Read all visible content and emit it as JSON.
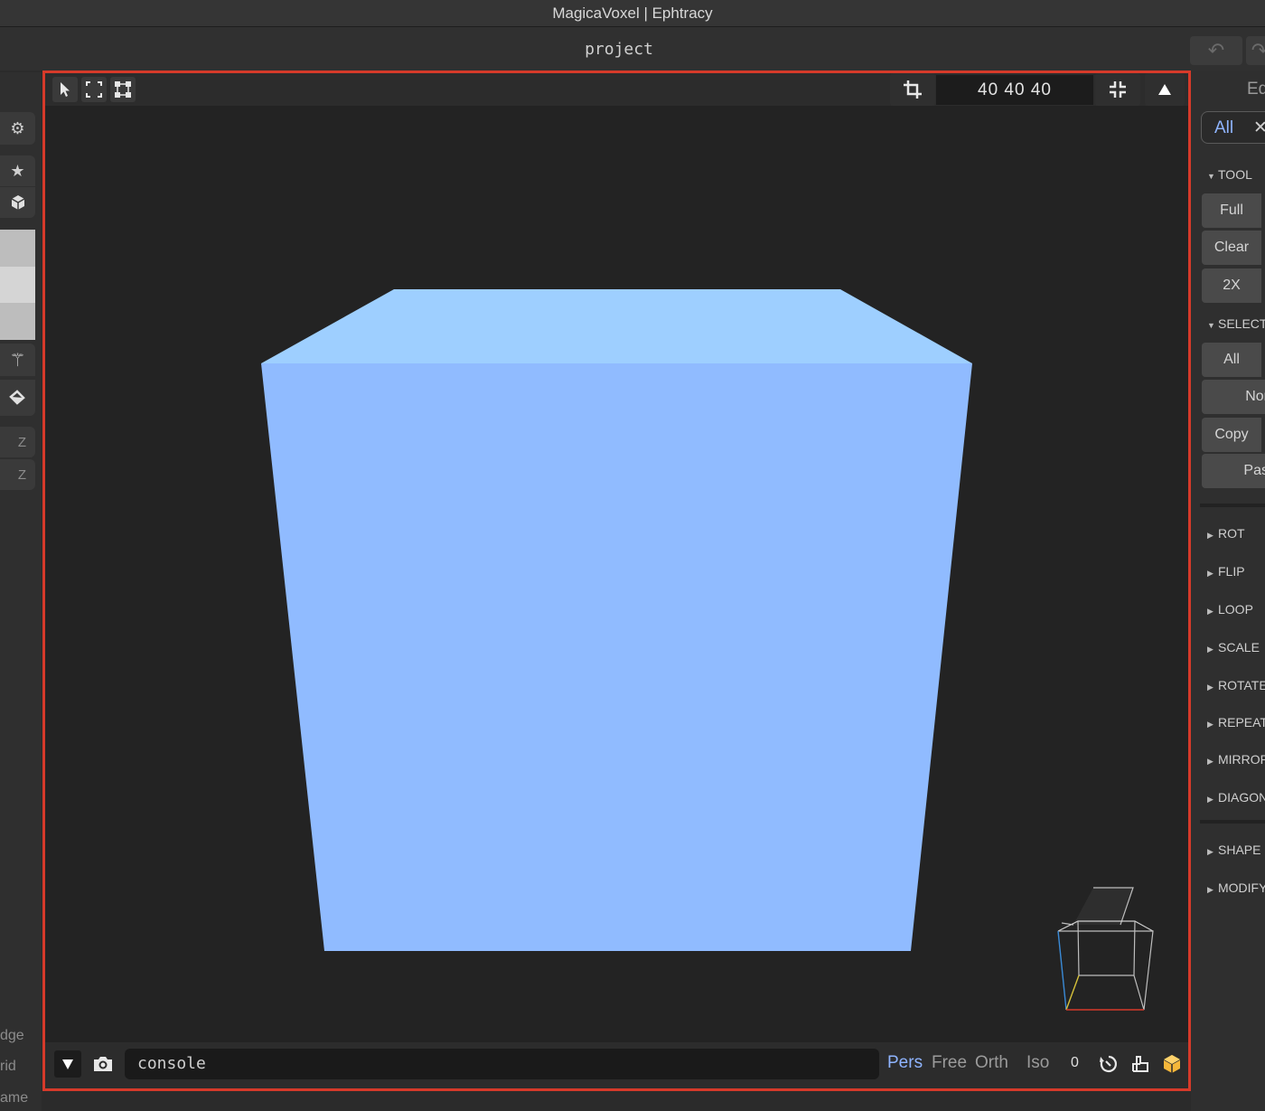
{
  "window": {
    "title": "MagicaVoxel | Ephtracy"
  },
  "project": {
    "name": "project"
  },
  "viewport": {
    "dimensions": "40  40  40",
    "console_text": "console",
    "view_modes": [
      "Pers",
      "Free",
      "Orth",
      "Iso"
    ],
    "active_view": "Pers",
    "counter": "0",
    "model_color": "#90bbff",
    "model_top_color": "#9ecfff"
  },
  "left": {
    "axis_labels": [
      "Z",
      "Z"
    ],
    "bottom_labels": [
      "dge",
      "rid",
      "ame"
    ]
  },
  "right": {
    "header": "Ed",
    "filter_tab": "All",
    "tool_section": "TOOL",
    "tool_buttons": [
      "Full",
      "Clear",
      "2X"
    ],
    "select_section": "SELECT",
    "select_buttons": [
      "All",
      "Nor",
      "Copy",
      "Pas"
    ],
    "sections": [
      "ROT",
      "FLIP",
      "LOOP",
      "SCALE",
      "ROTATE",
      "REPEAT",
      "MIRROR",
      "DIAGON",
      "SHAPE",
      "MODIFY"
    ]
  }
}
